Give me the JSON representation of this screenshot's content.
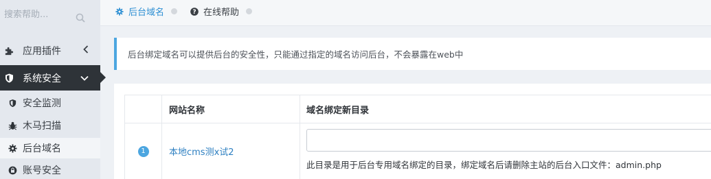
{
  "sidebar": {
    "search_placeholder": "搜索帮助...",
    "items": [
      {
        "label": "应用插件",
        "icon": "puzzle-icon",
        "arrow": "‹"
      },
      {
        "label": "系统安全",
        "icon": "shield-icon",
        "arrow": "⌄"
      }
    ],
    "sub_items": [
      {
        "label": "安全监测",
        "icon": "shield-icon"
      },
      {
        "label": "木马扫描",
        "icon": "bug-icon"
      },
      {
        "label": "后台域名",
        "icon": "gear-icon"
      },
      {
        "label": "账号安全",
        "icon": "lock-icon"
      }
    ]
  },
  "tabs": [
    {
      "label": "后台域名",
      "icon": "gear-icon",
      "active": true
    },
    {
      "label": "在线帮助",
      "icon": "question-icon",
      "active": false
    }
  ],
  "alert": {
    "text": "后台绑定域名可以提供后台的安全性，只能通过指定的域名访问后台，不会暴露在web中"
  },
  "table": {
    "headers": [
      "",
      "网站名称",
      "域名绑定新目录"
    ],
    "rows": [
      {
        "index": "1",
        "site_name": "本地cms测x试2",
        "directory_value": "",
        "hint": "此目录是用于后台专用域名绑定的目录，绑定域名后请删除主站的后台入口文件：admin.php"
      }
    ]
  },
  "colors": {
    "accent": "#2d8fd3",
    "sidebar_active": "#2e3338",
    "sidebar_bg": "#e4e8ee",
    "badge": "#4ca6e0"
  }
}
